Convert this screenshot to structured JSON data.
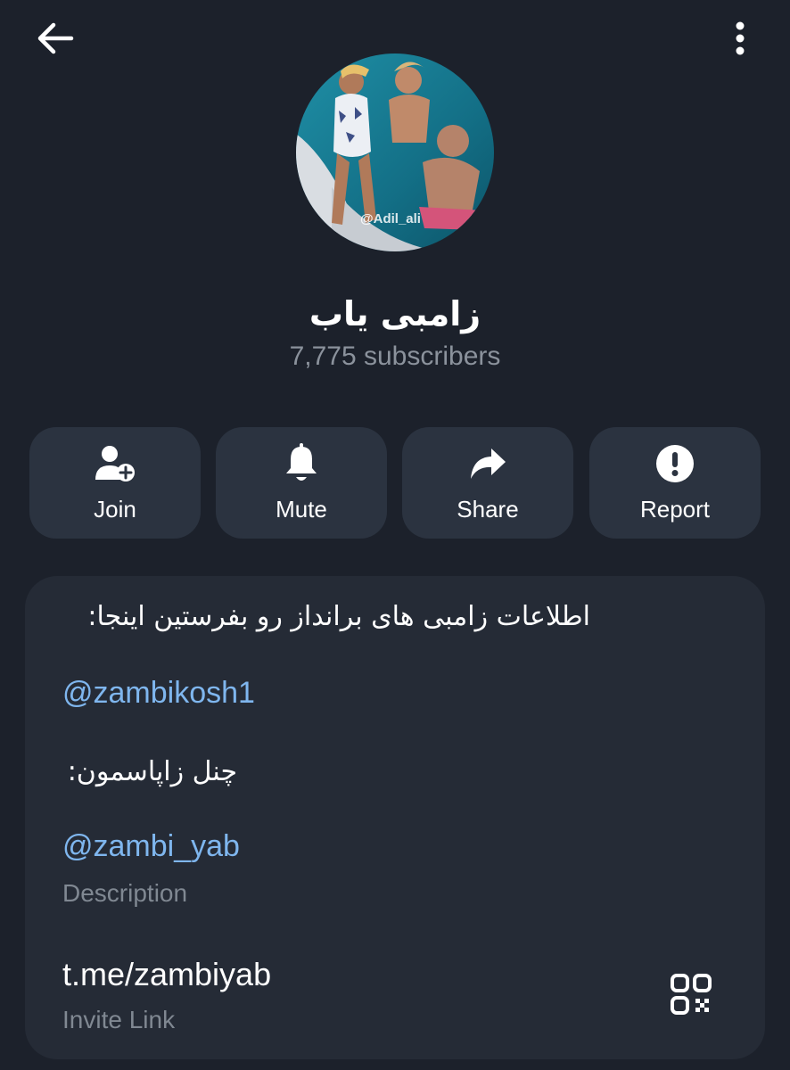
{
  "header": {
    "back_icon": "arrow-left-icon",
    "menu_icon": "more-vertical-icon"
  },
  "channel": {
    "title": "زامبی یاب",
    "subscribers": "7,775 subscribers",
    "avatar_watermark": "@Adil_ali"
  },
  "actions": [
    {
      "label": "Join",
      "icon": "user-plus-icon"
    },
    {
      "label": "Mute",
      "icon": "bell-icon"
    },
    {
      "label": "Share",
      "icon": "share-arrow-icon"
    },
    {
      "label": "Report",
      "icon": "alert-circle-icon"
    }
  ],
  "info": {
    "description_lines": [
      "اطلاعات زامبی های برانداز رو بفرستین اینجا:",
      "@zambikosh1",
      "چنل زاپاسمون:",
      "@zambi_yab"
    ],
    "description_caption": "Description",
    "invite_link": "t.me/zambiyab",
    "invite_caption": "Invite Link",
    "qr_icon": "qr-code-icon"
  },
  "colors": {
    "background": "#1c212b",
    "card": "#252b36",
    "button": "#2b3340",
    "link_accent": "#7fb6ee",
    "muted_text": "#8b929c"
  }
}
